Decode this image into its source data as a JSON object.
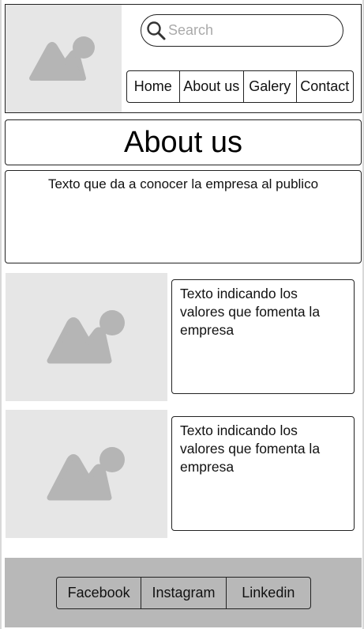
{
  "header": {
    "search": {
      "placeholder": "Search"
    },
    "nav": [
      {
        "label": "Home"
      },
      {
        "label": "About us"
      },
      {
        "label": "Galery"
      },
      {
        "label": "Contact"
      }
    ]
  },
  "main": {
    "title": "About us",
    "intro": "Texto que da a conocer la empresa al publico",
    "values_rows": [
      {
        "text": "Texto indicando los valores que fomenta la empresa"
      },
      {
        "text": "Texto indicando los valores que fomenta la empresa"
      }
    ]
  },
  "footer": {
    "social": [
      {
        "label": "Facebook"
      },
      {
        "label": "Instagram"
      },
      {
        "label": "Linkedin"
      }
    ]
  },
  "colors": {
    "placeholder_bg": "#e6e6e6",
    "placeholder_icon": "#b5b5b5",
    "footer_bg": "#b8b8b8",
    "border": "#222222"
  }
}
